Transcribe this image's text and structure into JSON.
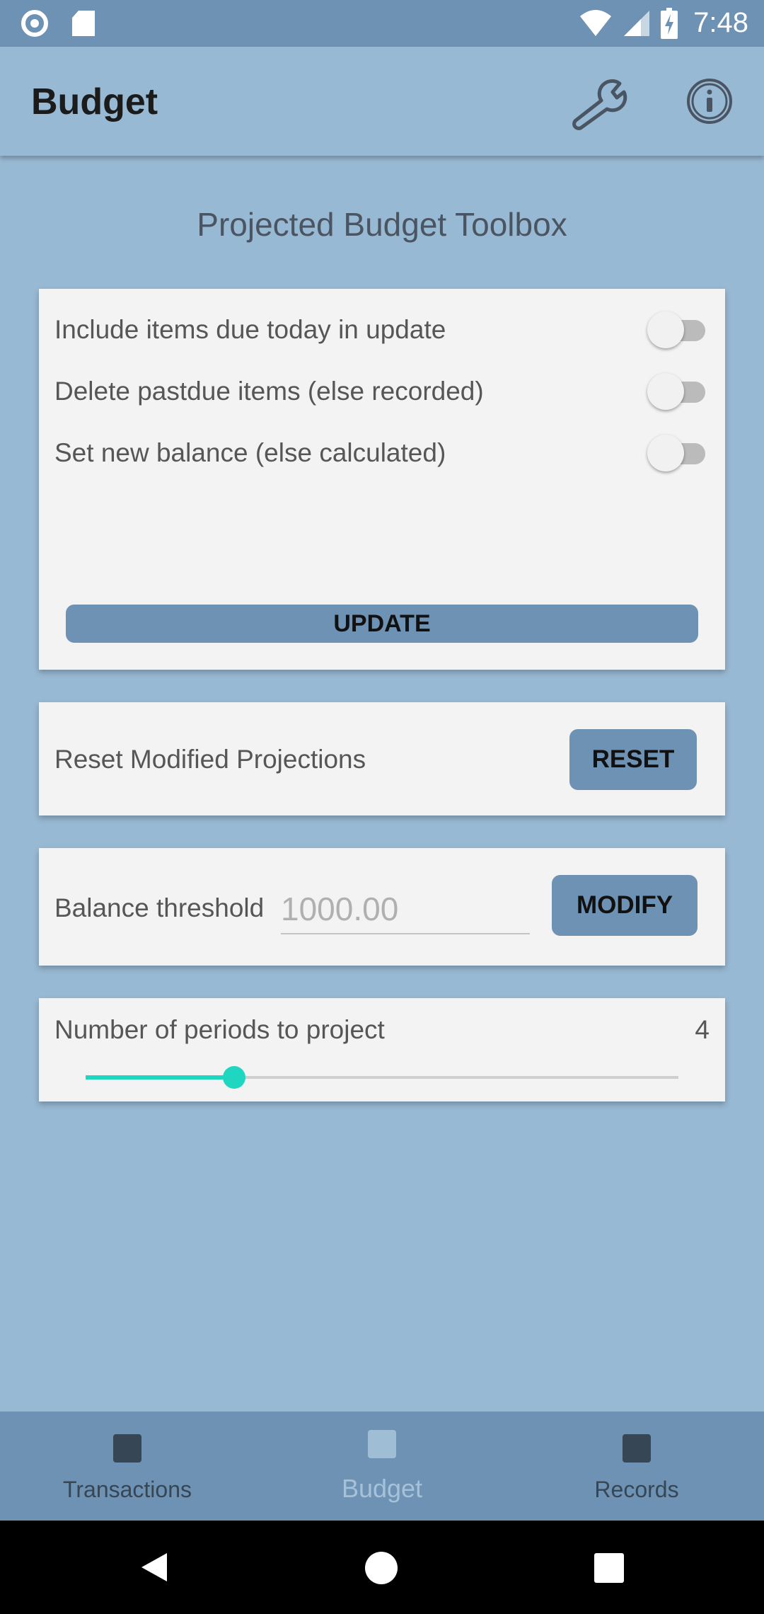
{
  "status_bar": {
    "time": "7:48",
    "icons": [
      "sync-circle-icon",
      "sd-card-icon",
      "wifi-icon",
      "cell-signal-icon",
      "battery-charging-icon"
    ]
  },
  "app_bar": {
    "title": "Budget",
    "actions": [
      {
        "name": "settings",
        "icon": "wrench-icon"
      },
      {
        "name": "info",
        "icon": "info-icon"
      }
    ]
  },
  "page_title": "Projected Budget Toolbox",
  "options_card": {
    "options": [
      {
        "label": "Include items due today in update",
        "checked": false
      },
      {
        "label": "Delete pastdue items (else recorded)",
        "checked": false
      },
      {
        "label": "Set new balance (else calculated)",
        "checked": false
      }
    ],
    "update_label": "UPDATE"
  },
  "reset_card": {
    "label": "Reset Modified Projections",
    "button_label": "RESET"
  },
  "threshold_card": {
    "label": "Balance threshold",
    "placeholder": "1000.00",
    "button_label": "MODIFY"
  },
  "periods_card": {
    "label": "Number of periods to project",
    "value": "4",
    "slider_fraction": 0.25
  },
  "bottom_nav": [
    {
      "label": "Transactions",
      "active": false
    },
    {
      "label": "Budget",
      "active": true
    },
    {
      "label": "Records",
      "active": false
    }
  ],
  "colors": {
    "background": "#98b9d4",
    "status_bar": "#6e92b3",
    "card": "#f3f3f3",
    "button": "#6e92b3",
    "accent": "#1fd6c0"
  }
}
